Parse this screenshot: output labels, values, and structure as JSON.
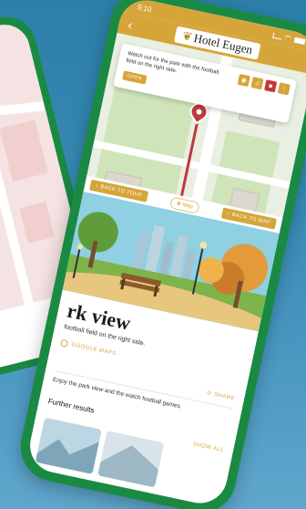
{
  "status": {
    "time": "5:10"
  },
  "header": {
    "logo_text": "Hotel Eugen",
    "back_icon": "chevron-left-icon"
  },
  "popup": {
    "text": "Watch out for the park with the football field on the right side.",
    "open_label": "OPEN"
  },
  "tabs": {
    "back_to_tour": "BACK TO TOUR",
    "map": "Map",
    "back_to_map": "BACK TO MAP"
  },
  "detail": {
    "title": "rk view",
    "subtitle": "football field on the right side.",
    "google_maps": "GOOGLE MAPS",
    "share": "SHARE",
    "description": "Enjoy the park view and the watch football games."
  },
  "further": {
    "title": "Further results",
    "show_all": "SHOW ALL"
  },
  "colors": {
    "brand_gold": "#d6a53a",
    "frame_green": "#1a8a43",
    "pin_red": "#c0393b",
    "background": "#3a8cb8"
  }
}
